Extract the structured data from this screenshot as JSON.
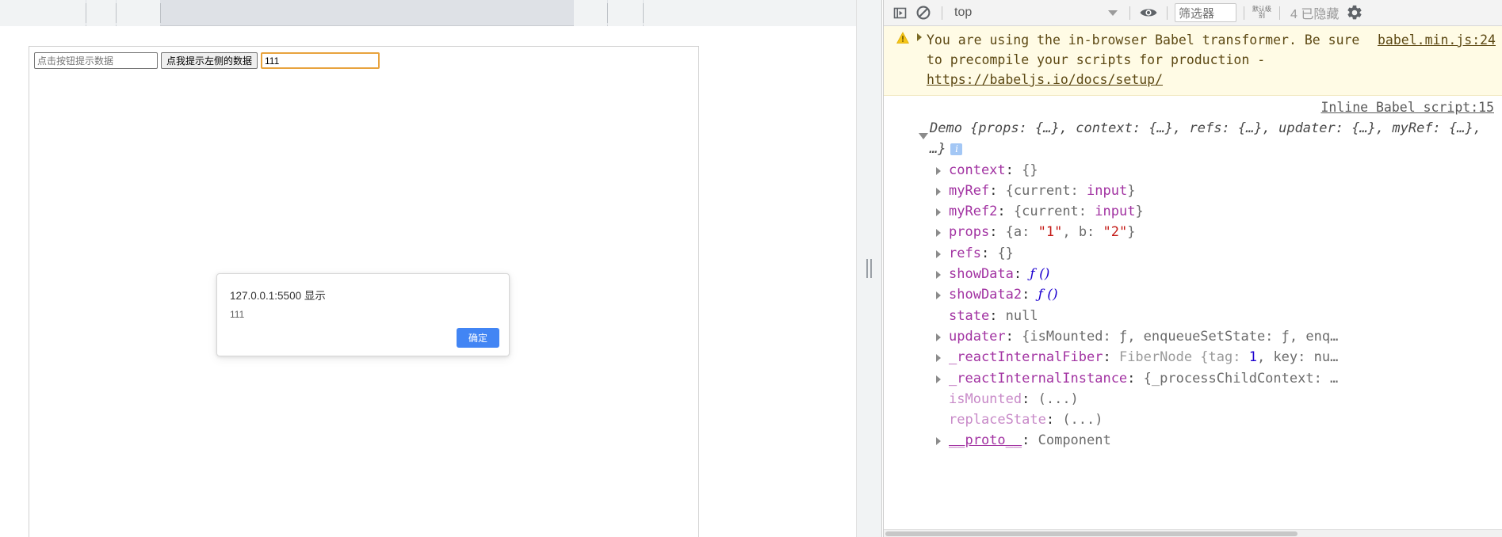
{
  "page": {
    "form": {
      "tip_input_placeholder": "点击按钮提示数据",
      "tip_button_label": "点我提示左侧的数据",
      "focused_input_value": "111"
    },
    "dialog": {
      "origin_text": "127.0.0.1:5500 显示",
      "message": "111",
      "ok_label": "确定"
    }
  },
  "devtools": {
    "toolbar": {
      "sidebar_toggle_icon": "show-console-sidebar-icon",
      "clear_icon": "clear-console-icon",
      "context_selected": "top",
      "context_caret_icon": "chevron-down-icon",
      "eye_icon": "live-expression-eye-icon",
      "filter_placeholder": "筛选器",
      "filter_value": "筛选器",
      "level_label": "默认级别",
      "hidden_count_text": "4 已隐藏",
      "settings_icon": "gear-icon"
    },
    "warning": {
      "icon": "warning-triangle-icon",
      "expand_icon": "triangle-right-icon",
      "text_part1": "You are using the in-browser Babel ",
      "source": "babel.min.js:24",
      "text_part2": "transformer. Be sure to precompile your scripts for production - ",
      "link": "https://babeljs.io/docs/setup/"
    },
    "source_link": "Inline Babel script:15",
    "object": {
      "header": "Demo {props: {…}, context: {…}, refs: {…}, updater: {…}, myRef: {…}, …}",
      "info_badge": "i",
      "expand_icon": "triangle-down-icon",
      "properties": [
        {
          "expandable": true,
          "key": "context",
          "sep": ": ",
          "value": "{}",
          "value_class": "v-dark"
        },
        {
          "expandable": true,
          "key": "myRef",
          "sep": ": ",
          "value": "{current: input}",
          "value_class": "v-mixed-input"
        },
        {
          "expandable": true,
          "key": "myRef2",
          "sep": ": ",
          "value": "{current: input}",
          "value_class": "v-mixed-input"
        },
        {
          "expandable": true,
          "key": "props",
          "sep": ": ",
          "value": "{a: \"1\", b: \"2\"}",
          "value_class": "v-mixed-props"
        },
        {
          "expandable": true,
          "key": "refs",
          "sep": ": ",
          "value": "{}",
          "value_class": "v-dark"
        },
        {
          "expandable": true,
          "key": "showData",
          "sep": ": ",
          "value": "ƒ ()",
          "value_class": "v-fn"
        },
        {
          "expandable": true,
          "key": "showData2",
          "sep": ": ",
          "value": "ƒ ()",
          "value_class": "v-fn"
        },
        {
          "expandable": false,
          "key": "state",
          "sep": ": ",
          "value": "null",
          "value_class": "v-plain"
        },
        {
          "expandable": true,
          "key": "updater",
          "sep": ": ",
          "value": "{isMounted: ƒ, enqueueSetState: ƒ, enq…",
          "value_class": "v-mixed-updater"
        },
        {
          "expandable": true,
          "key": "_reactInternalFiber",
          "sep": ": ",
          "value": "FiberNode {tag: 1, key: nu…",
          "value_class": "v-mixed-fiber"
        },
        {
          "expandable": true,
          "key": "_reactInternalInstance",
          "sep": ": ",
          "value": "{_processChildContext: …",
          "value_class": "v-plain"
        },
        {
          "expandable": false,
          "key": "isMounted",
          "sep": ": ",
          "value": "(...)",
          "value_class": "v-plain",
          "faded": true
        },
        {
          "expandable": false,
          "key": "replaceState",
          "sep": ": ",
          "value": "(...)",
          "value_class": "v-plain",
          "faded": true
        },
        {
          "expandable": true,
          "key": "__proto__",
          "sep": ": ",
          "value": "Component",
          "value_class": "v-dark",
          "proto": true
        }
      ]
    }
  },
  "colors": {
    "warn_bg": "#fffbe5",
    "warn_text": "#5c4813",
    "key_purple": "#a233a2",
    "string_red": "#c41a16",
    "number_blue": "#1c00cf",
    "accent_blue": "#4285f4",
    "focus_orange": "#e8a33d"
  }
}
